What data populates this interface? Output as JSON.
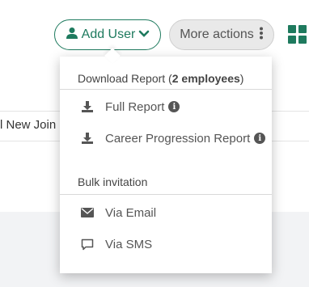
{
  "header": {
    "add_user_label": "Add User",
    "more_actions_label": "More actions"
  },
  "background": {
    "partial_row_text": "l New Join"
  },
  "dropdown": {
    "download_section": {
      "title_prefix": "Download Report (",
      "title_count": "2 employees",
      "title_suffix": ")",
      "items": [
        {
          "label": "Full Report",
          "icon": "download-icon",
          "has_info": true
        },
        {
          "label": "Career Progression Report",
          "icon": "download-icon",
          "has_info": true
        }
      ]
    },
    "bulk_section": {
      "title": "Bulk invitation",
      "items": [
        {
          "label": "Via Email",
          "icon": "envelope-icon"
        },
        {
          "label": "Via SMS",
          "icon": "chat-bubble-icon"
        }
      ]
    },
    "info_glyph": "i"
  },
  "colors": {
    "accent": "#1e7a5e",
    "more_bg": "#e9e9e9",
    "lower_bg": "#f2f3f5"
  }
}
